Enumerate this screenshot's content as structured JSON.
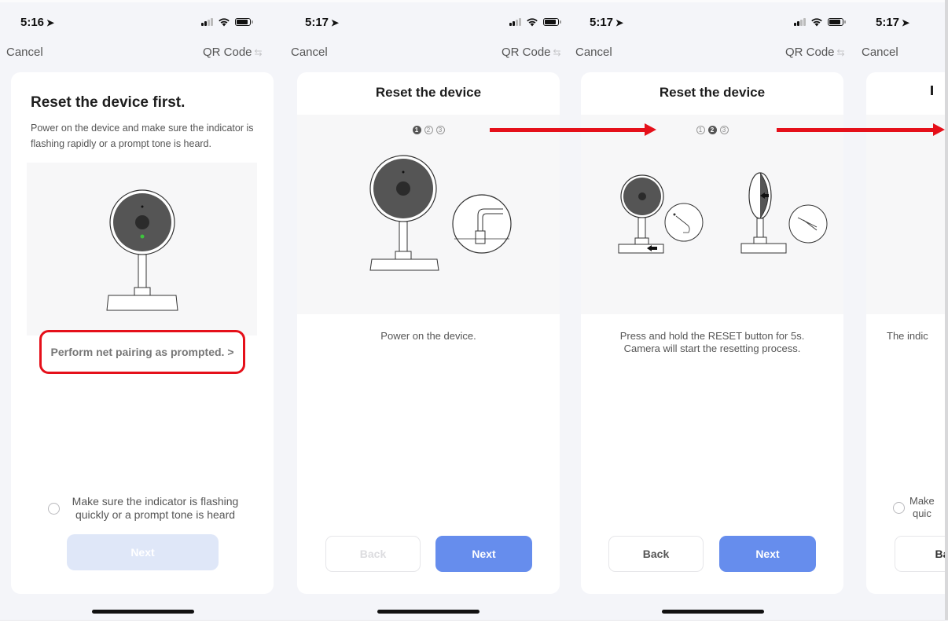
{
  "screens": [
    {
      "time": "5:16",
      "nav": {
        "cancel": "Cancel",
        "qr": "QR Code",
        "qr_icon": "swap-icon"
      },
      "title": "Reset the device first.",
      "description": "Power on the device and make sure the indicator is flashing rapidly or a prompt tone is heard.",
      "pair_link": "Perform net pairing as prompted. >",
      "checkbox_label": "Make sure the indicator is flashing quickly or a prompt tone is heard",
      "checkbox_checked": false,
      "next": "Next",
      "next_enabled": false
    },
    {
      "time": "5:17",
      "nav": {
        "cancel": "Cancel",
        "qr": "QR Code",
        "qr_icon": "swap-icon"
      },
      "title": "Reset the device",
      "steps": [
        "1",
        "2",
        "3"
      ],
      "active_step": 1,
      "instruction": "Power on the device.",
      "back": "Back",
      "back_enabled": false,
      "next": "Next"
    },
    {
      "time": "5:17",
      "nav": {
        "cancel": "Cancel",
        "qr": "QR Code",
        "qr_icon": "swap-icon"
      },
      "title": "Reset the device",
      "steps": [
        "1",
        "2",
        "3"
      ],
      "active_step": 2,
      "instruction_line1": "Press and hold the RESET button for 5s.",
      "instruction_line2": "Camera will start the resetting process.",
      "back": "Back",
      "back_enabled": true,
      "next": "Next"
    },
    {
      "time": "5:17",
      "nav": {
        "cancel": "Cancel"
      },
      "instruction_partial": "The indic",
      "checkbox_partial_line1": "Make",
      "checkbox_partial_line2": "quic",
      "back_partial": "Ba"
    }
  ],
  "annotations": {
    "highlight_color": "#e5101a",
    "accent_color": "#668ded"
  }
}
